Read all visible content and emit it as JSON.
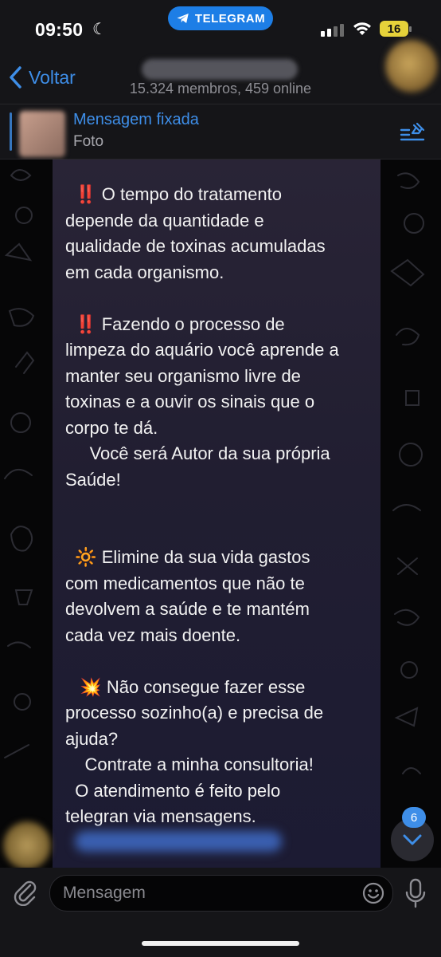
{
  "status_bar": {
    "time": "09:50",
    "app_pill": "TELEGRAM",
    "battery": "16",
    "icons": [
      "moon-icon",
      "telegram-icon",
      "signal-icon",
      "wifi-icon",
      "battery-icon"
    ]
  },
  "header": {
    "back_label": "Voltar",
    "members": "15.324 membros, 459 online"
  },
  "pinned": {
    "title": "Mensagem fixada",
    "subtitle": "Foto"
  },
  "message": {
    "text": "  ‼️ O tempo do tratamento\ndepende da quantidade e\nqualidade de toxinas acumuladas\nem cada organismo.\n\n  ‼️ Fazendo o processo de\nlimpeza do aquário você aprende a\nmanter seu organismo livre de\ntoxinas e a ouvir os sinais que o\ncorpo te dá.\n     Você será Autor da sua própria\nSaúde!\n\n\n  🔆 Elimine da sua vida gastos\ncom medicamentos que não te\ndevolvem a saúde e te mantém\ncada vez mais doente.\n\n   💥 Não consegue fazer esse\nprocesso sozinho(a) e precisa de\najuda?\n    Contrate a minha consultoria!\n  O atendimento é feito pelo\ntelegran via mensagens."
  },
  "scroll": {
    "unread_count": "6"
  },
  "input": {
    "placeholder": "Mensagem"
  },
  "colors": {
    "accent": "#3e8ee8",
    "bubble": "#241f35",
    "background": "#060607",
    "bar": "#151518"
  }
}
